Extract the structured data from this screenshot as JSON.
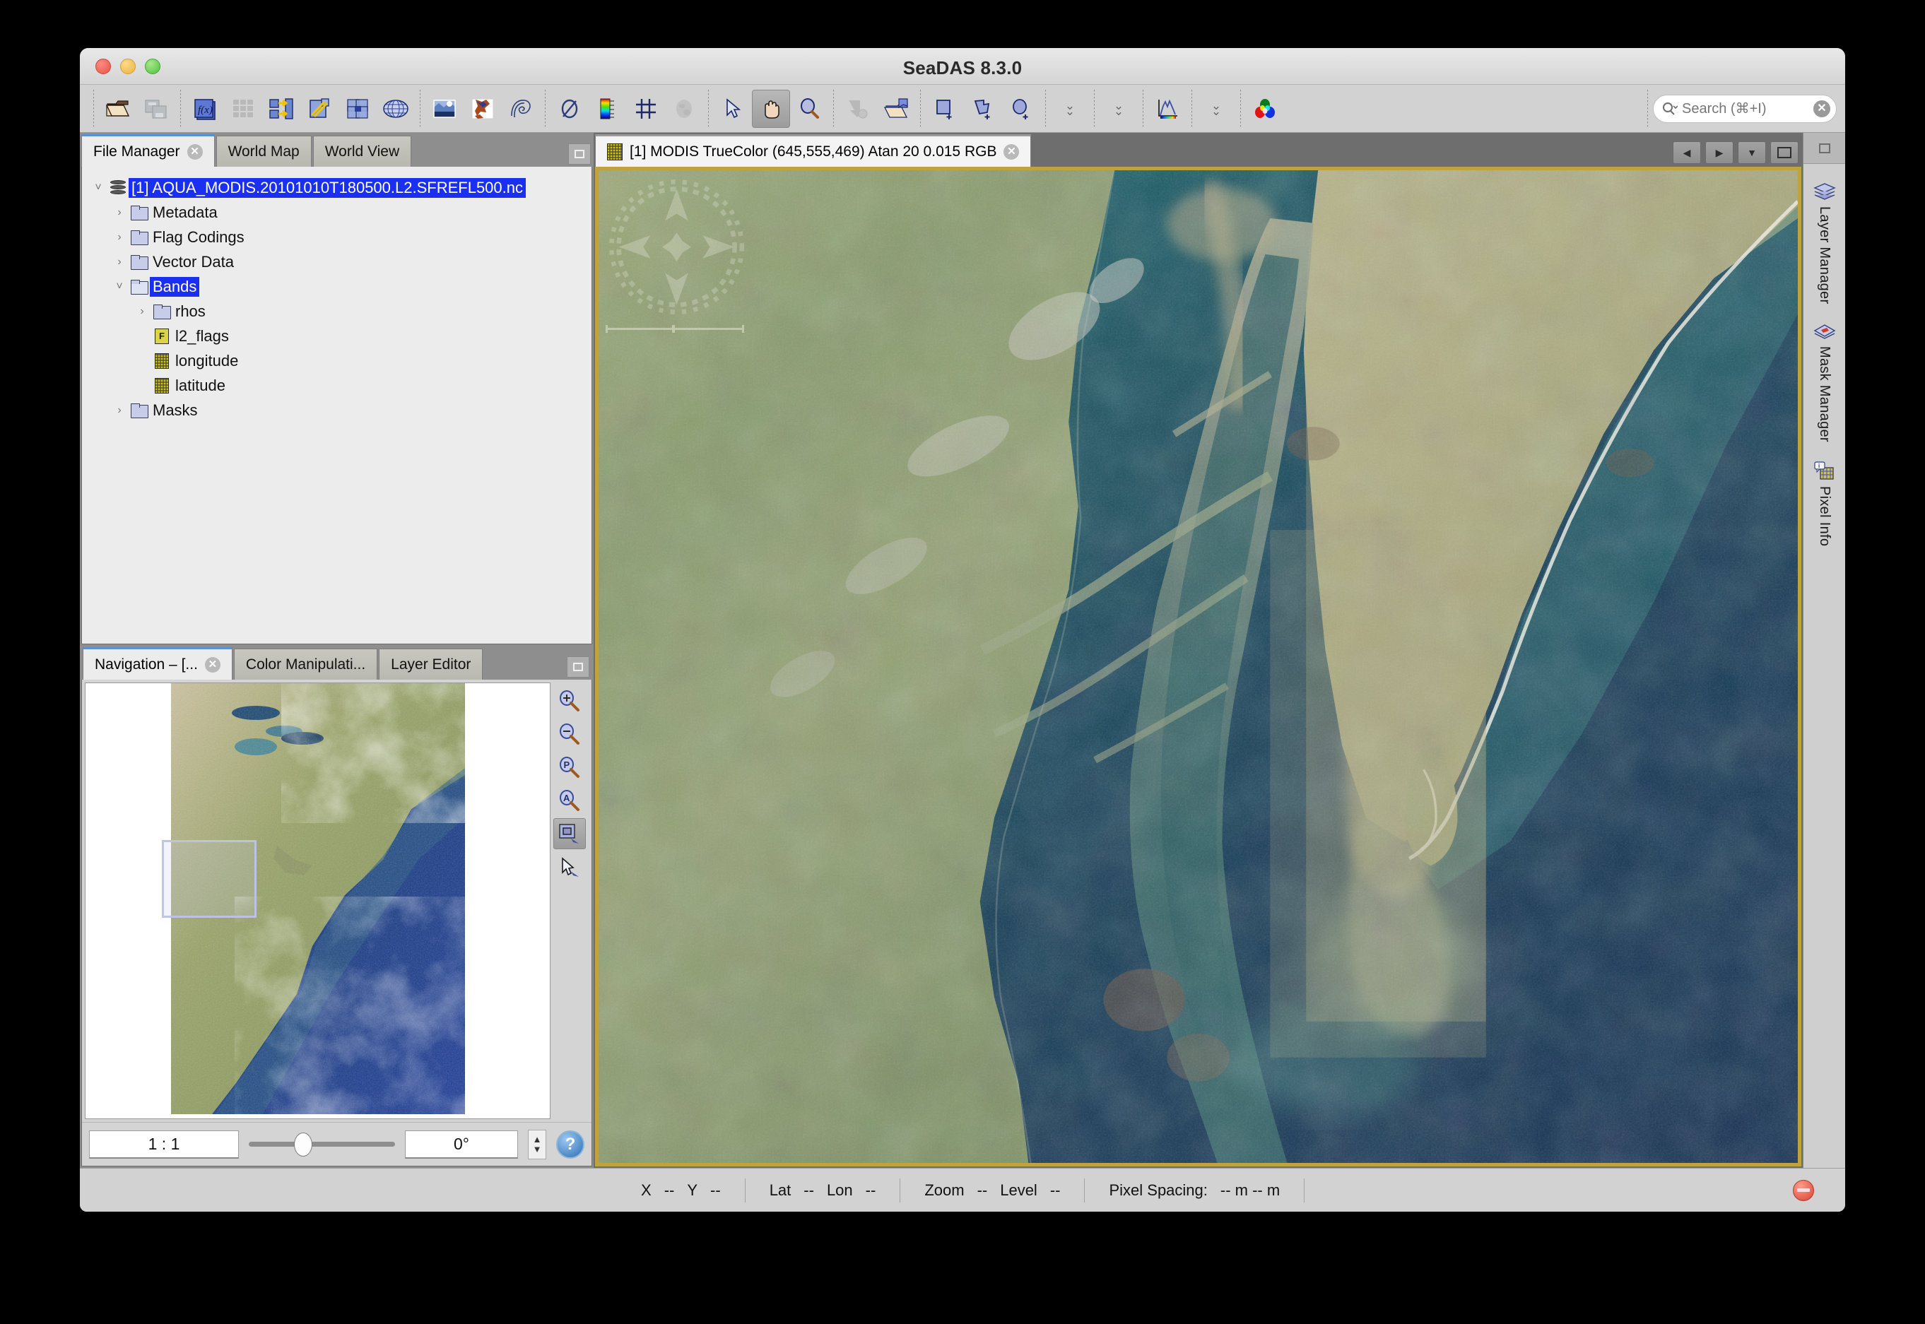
{
  "window": {
    "title": "SeaDAS 8.3.0",
    "traffic_lights": [
      "close",
      "minimize",
      "maximize"
    ]
  },
  "toolbar": {
    "groups": [
      {
        "items": [
          {
            "name": "open-product-icon",
            "label": "Open Product"
          },
          {
            "name": "save-product-icon",
            "label": "Save Product",
            "disabled": true
          }
        ]
      },
      {
        "items": [
          {
            "name": "band-maths-icon",
            "label": "Band Maths"
          },
          {
            "name": "product-grid-icon",
            "label": "Product Grid",
            "disabled": true
          },
          {
            "name": "band-select-icon",
            "label": "Band Select"
          },
          {
            "name": "subset-icon",
            "label": "Subset"
          },
          {
            "name": "collocation-icon",
            "label": "Collocation"
          },
          {
            "name": "reprojection-icon",
            "label": "Reprojection"
          }
        ]
      },
      {
        "items": [
          {
            "name": "open-rgb-image-icon",
            "label": "Open RGB Image View"
          },
          {
            "name": "landmask-icon",
            "label": "Land Mask"
          },
          {
            "name": "contour-icon",
            "label": "Contour Lines"
          }
        ]
      },
      {
        "items": [
          {
            "name": "no-data-overlay-icon",
            "label": "No-Data Overlay"
          },
          {
            "name": "colorbar-icon",
            "label": "Colour Bar Overlay"
          },
          {
            "name": "graticule-icon",
            "label": "Graticule Overlay"
          },
          {
            "name": "mask-overlay-icon",
            "label": "Mask Overlay"
          }
        ]
      },
      {
        "items": [
          {
            "name": "selection-tool-icon",
            "label": "Selection Tool"
          },
          {
            "name": "pan-tool-icon",
            "label": "Panning Tool",
            "active": true
          },
          {
            "name": "zoom-tool-icon",
            "label": "Zooming Tool"
          }
        ]
      },
      {
        "items": [
          {
            "name": "export-view-icon",
            "label": "Export View as Image",
            "disabled": true
          },
          {
            "name": "open-session-icon",
            "label": "Open Session"
          }
        ]
      },
      {
        "items": [
          {
            "name": "rectangle-drawing-icon",
            "label": "Rectangle Drawing Tool"
          },
          {
            "name": "polygon-drawing-icon",
            "label": "Polygon Drawing Tool"
          },
          {
            "name": "ellipse-drawing-icon",
            "label": "Ellipse Drawing Tool"
          }
        ]
      },
      {
        "items": [
          {
            "name": "chevron-down-icon",
            "label": "More"
          }
        ]
      },
      {
        "items": [
          {
            "name": "chevron-down-icon",
            "label": "More"
          }
        ]
      },
      {
        "items": [
          {
            "name": "histogram-icon",
            "label": "Colour Manipulation"
          }
        ]
      },
      {
        "items": [
          {
            "name": "chevron-down-icon",
            "label": "More"
          }
        ]
      },
      {
        "items": [
          {
            "name": "rgb-profile-icon",
            "label": "RGB Profile"
          }
        ]
      }
    ],
    "search": {
      "placeholder": "Search (⌘+I)",
      "value": "Search (⌘+I)",
      "icon": "search-icon",
      "clear_icon": "clear-icon"
    }
  },
  "left_panel": {
    "tabs": [
      {
        "label": "File Manager",
        "selected": true,
        "closable": true
      },
      {
        "label": "World Map",
        "selected": false,
        "closable": false
      },
      {
        "label": "World View",
        "selected": false,
        "closable": false
      }
    ],
    "float_button": "float-panel-icon",
    "tree": [
      {
        "label": "[1] AQUA_MODIS.20101010T180500.L2.SFREFL500.nc",
        "indent": 0,
        "arrow": "down",
        "icon": "product-icon",
        "selected": true
      },
      {
        "label": "Metadata",
        "indent": 1,
        "arrow": "right",
        "icon": "folder-icon",
        "selected": false
      },
      {
        "label": "Flag Codings",
        "indent": 1,
        "arrow": "right",
        "icon": "folder-icon",
        "selected": false
      },
      {
        "label": "Vector Data",
        "indent": 1,
        "arrow": "right",
        "icon": "folder-icon",
        "selected": false
      },
      {
        "label": "Bands",
        "indent": 1,
        "arrow": "down",
        "icon": "folder-open-icon",
        "selected": true
      },
      {
        "label": "rhos",
        "indent": 2,
        "arrow": "right",
        "icon": "folder-icon",
        "selected": false
      },
      {
        "label": "l2_flags",
        "indent": 2,
        "arrow": "none",
        "icon": "flag-band-icon",
        "selected": false
      },
      {
        "label": "longitude",
        "indent": 2,
        "arrow": "none",
        "icon": "band-icon",
        "selected": false
      },
      {
        "label": "latitude",
        "indent": 2,
        "arrow": "none",
        "icon": "band-icon",
        "selected": false
      },
      {
        "label": "Masks",
        "indent": 1,
        "arrow": "right",
        "icon": "folder-icon",
        "selected": false
      }
    ]
  },
  "navigation_panel": {
    "tabs": [
      {
        "label": "Navigation – [...",
        "selected": true,
        "closable": true
      },
      {
        "label": "Color Manipulati...",
        "selected": false,
        "closable": false
      },
      {
        "label": "Layer Editor",
        "selected": false,
        "closable": false
      }
    ],
    "float_button": "float-panel-icon",
    "tools": [
      {
        "name": "zoom-in-icon",
        "label": "Zoom In",
        "active": false
      },
      {
        "name": "zoom-out-icon",
        "label": "Zoom Out",
        "active": false
      },
      {
        "name": "zoom-to-pixel-icon",
        "label": "Zoom to Pixel Resolution",
        "active": false
      },
      {
        "name": "zoom-all-icon",
        "label": "Zoom All",
        "active": false
      },
      {
        "name": "sync-views-icon",
        "label": "Synchronise Image Views",
        "active": true
      },
      {
        "name": "sync-cursor-icon",
        "label": "Synchronise Cursor",
        "active": false
      }
    ],
    "zoom_factor": "1 : 1",
    "rotation": "0°",
    "slider_position_pct": 31,
    "help_button": "help-icon"
  },
  "image_view": {
    "tab": {
      "label": "[1] MODIS TrueColor (645,555,469) Atan 20 0.015 RGB",
      "icon": "image-band-icon",
      "closable": true,
      "selected": true
    },
    "nav_buttons": [
      {
        "name": "scroll-left-button",
        "glyph": "◀"
      },
      {
        "name": "scroll-right-button",
        "glyph": "▶"
      },
      {
        "name": "tab-list-dropdown-button",
        "glyph": "▼"
      },
      {
        "name": "maximize-view-button",
        "glyph": ""
      }
    ],
    "overlays": [
      {
        "name": "compass-rose-overlay"
      },
      {
        "name": "scale-bar-overlay"
      }
    ],
    "border_color": "#bfa33c"
  },
  "right_rail": {
    "float_button": "float-panel-icon",
    "items": [
      {
        "label": "Layer Manager",
        "icon": "layers-icon"
      },
      {
        "label": "Mask Manager",
        "icon": "mask-icon"
      },
      {
        "label": "Pixel Info",
        "icon": "pixel-info-icon"
      }
    ]
  },
  "status_bar": {
    "groups": [
      {
        "name": "pixel-coords",
        "fields": [
          {
            "label": "X",
            "value": "--"
          },
          {
            "label": "Y",
            "value": "--"
          }
        ]
      },
      {
        "name": "geo-coords",
        "fields": [
          {
            "label": "Lat",
            "value": "--"
          },
          {
            "label": "Lon",
            "value": "--"
          }
        ]
      },
      {
        "name": "zoom-level",
        "fields": [
          {
            "label": "Zoom",
            "value": "--"
          },
          {
            "label": "Level",
            "value": "--"
          }
        ]
      },
      {
        "name": "pixel-spacing",
        "fields": [
          {
            "label": "Pixel Spacing:",
            "value": "-- m -- m"
          }
        ]
      }
    ],
    "stop_indicator": "stop-icon"
  },
  "colors": {
    "window_bg": "#d4d4d4",
    "selection_blue": "#1a2ff0",
    "tab_selected_bg": "#ececec",
    "tab_accent": "#5b8fd6",
    "image_border": "#bfa33c",
    "status_red": "#d94436"
  }
}
